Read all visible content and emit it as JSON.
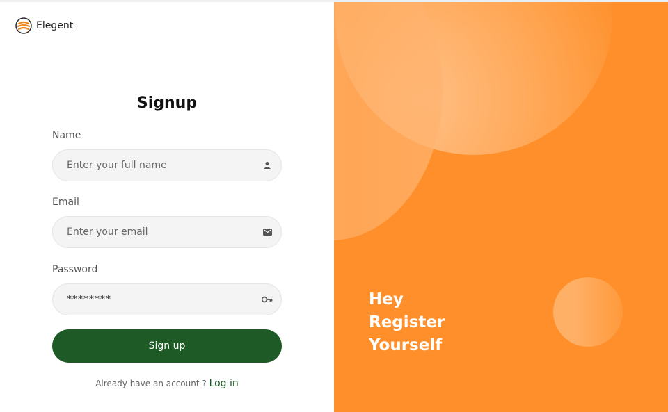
{
  "brand": {
    "name": "Elegent",
    "logo_icon": "stacked-waves-logo-icon"
  },
  "form": {
    "title": "Signup",
    "name": {
      "label": "Name",
      "placeholder": "Enter your full name",
      "icon": "person-icon"
    },
    "email": {
      "label": "Email",
      "placeholder": "Enter your email",
      "icon": "envelope-icon"
    },
    "password": {
      "label": "Password",
      "value": "********",
      "icon": "key-icon"
    },
    "submit_label": "Sign up",
    "footer_text": "Already have an account ?",
    "login_link": "Log in"
  },
  "hero": {
    "line1": "Hey",
    "line2": "Register",
    "line3": "Yourself"
  },
  "colors": {
    "accent": "#fe8f2a",
    "primary": "#1e5a25"
  }
}
